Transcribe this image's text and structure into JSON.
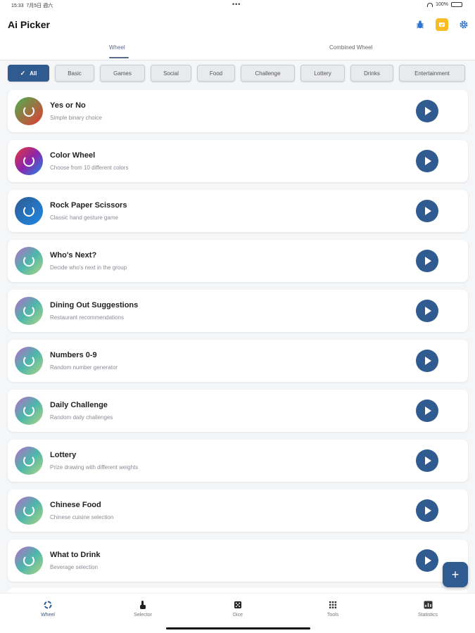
{
  "status_bar": {
    "time": "15:33",
    "date": "7月5日 週六",
    "dots": "•••",
    "battery": "100%"
  },
  "header": {
    "title": "Ai Picker",
    "icons": [
      "bug-icon",
      "pro-badge-icon",
      "gear-icon"
    ]
  },
  "tabs": [
    {
      "label": "Wheel",
      "selected": true
    },
    {
      "label": "Combined Wheel",
      "selected": false
    }
  ],
  "chips": [
    {
      "label": "All",
      "selected": true
    },
    {
      "label": "Basic"
    },
    {
      "label": "Games"
    },
    {
      "label": "Social"
    },
    {
      "label": "Food"
    },
    {
      "label": "Challenge"
    },
    {
      "label": "Lottery"
    },
    {
      "label": "Drinks"
    },
    {
      "label": "Entertainment"
    }
  ],
  "items": [
    {
      "title": "Yes or No",
      "subtitle": "Simple binary choice"
    },
    {
      "title": "Color Wheel",
      "subtitle": "Choose from 10 different colors"
    },
    {
      "title": "Rock Paper Scissors",
      "subtitle": "Classic hand gesture game"
    },
    {
      "title": "Who's Next?",
      "subtitle": "Decide who's next in the group"
    },
    {
      "title": "Dining Out Suggestions",
      "subtitle": "Restaurant recommendations"
    },
    {
      "title": "Numbers 0-9",
      "subtitle": "Random number generator"
    },
    {
      "title": "Daily Challenge",
      "subtitle": "Random daily challenges"
    },
    {
      "title": "Lottery",
      "subtitle": "Prize drawing with different weights"
    },
    {
      "title": "Chinese Food",
      "subtitle": "Chinese cuisine selection"
    },
    {
      "title": "What to Drink",
      "subtitle": "Beverage selection"
    }
  ],
  "fab": {
    "label": "+"
  },
  "bottom_nav": [
    {
      "label": "Wheel",
      "icon": "wheel-icon",
      "active": true
    },
    {
      "label": "Selector",
      "icon": "selector-icon"
    },
    {
      "label": "Dice",
      "icon": "dice-icon"
    },
    {
      "label": "Tools",
      "icon": "tools-icon"
    },
    {
      "label": "Statistics",
      "icon": "statistics-icon"
    }
  ],
  "colors": {
    "primary": "#2f5b91",
    "pro_badge": "#f8bd22"
  }
}
